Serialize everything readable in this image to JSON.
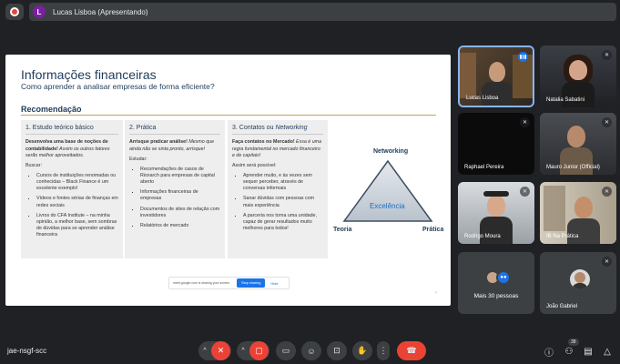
{
  "presenter": {
    "initial": "L",
    "label": "Lucas Lisboa (Apresentando)"
  },
  "slide": {
    "title": "Informações financeiras",
    "subtitle": "Como aprender a analisar empresas de forma eficiente?",
    "section": "Recomendação",
    "columns": [
      {
        "heading_plain": "1. Estudo teórico básico",
        "intro_bold": "Desenvolva uma base de noções de contabilidade!",
        "intro_rest": " Assim os outros fatores serão melhor aproveitados.",
        "list_title": "Buscar:",
        "items": [
          "Cursos de instituições renomadas ou conhecidas – Black Finance é um excelente exemplo!",
          "Vídeos e fontes sérias de finanças em redes sociais",
          "Livros do CFA Institute – na minha opinião, a melhor base, sem sombras de dúvidas para se aprender análise financeira"
        ]
      },
      {
        "heading_plain": "2. Prática",
        "intro_bold": "Arrisque praticar análise!",
        "intro_rest": " Mesmo que ainda não se sinta pronto, arrisque!",
        "list_title": "Estudar:",
        "items": [
          "Recomendações de casos de Rioxarch para empresas de capital aberto",
          "Informações financeiras de empresas",
          "Documentos de sites de relação com investidores",
          "Relatórios de mercado"
        ]
      },
      {
        "heading_plain": "3. Contatos ou ",
        "heading_italic": "Networking",
        "intro_bold": "Faça contatos no Mercado!",
        "intro_rest": " Essa é uma regra fundamental no mercado financeiro e de capitais!",
        "list_title": "Assim será possível:",
        "items": [
          "Aprender muito, e às vezes sem sequer perceber, através de conversas informais",
          "Sanar dúvidas com pessoas com mais experiência",
          "A parceria nos torna uma unidade, capaz de gerar resultados muito melhores para todos!"
        ]
      }
    ],
    "triangle": {
      "top": "Networking",
      "center": "Excelência",
      "left": "Teoria",
      "right": "Prática"
    },
    "share_banner": {
      "text": "meet.google.com is sharing your screen.",
      "stop": "Stop sharing",
      "hide": "Hide"
    }
  },
  "participants": [
    {
      "name": "Lucas Lisboa",
      "speaking": true
    },
    {
      "name": "Natalia Sabatini",
      "muted": true
    },
    {
      "name": "Raphael Pereira",
      "muted": true
    },
    {
      "name": "Mauro Junior (Official)",
      "muted": true
    },
    {
      "name": "Rodrigo Moura",
      "muted": true
    },
    {
      "name": "IB Na Prática",
      "muted": true
    },
    {
      "name": "Mais 30 pessoas"
    },
    {
      "name": "João Gabriel",
      "muted": true
    }
  ],
  "bottom": {
    "meeting_code": "jae-nsgf-scc",
    "people_count": "38"
  },
  "icons": [
    "record-icon",
    "mic-off-icon",
    "camera-off-icon",
    "captions-icon",
    "emoji-icon",
    "present-icon",
    "raise-hand-icon",
    "more-icon",
    "end-call-icon",
    "info-icon",
    "people-icon",
    "chat-icon",
    "activities-icon"
  ]
}
